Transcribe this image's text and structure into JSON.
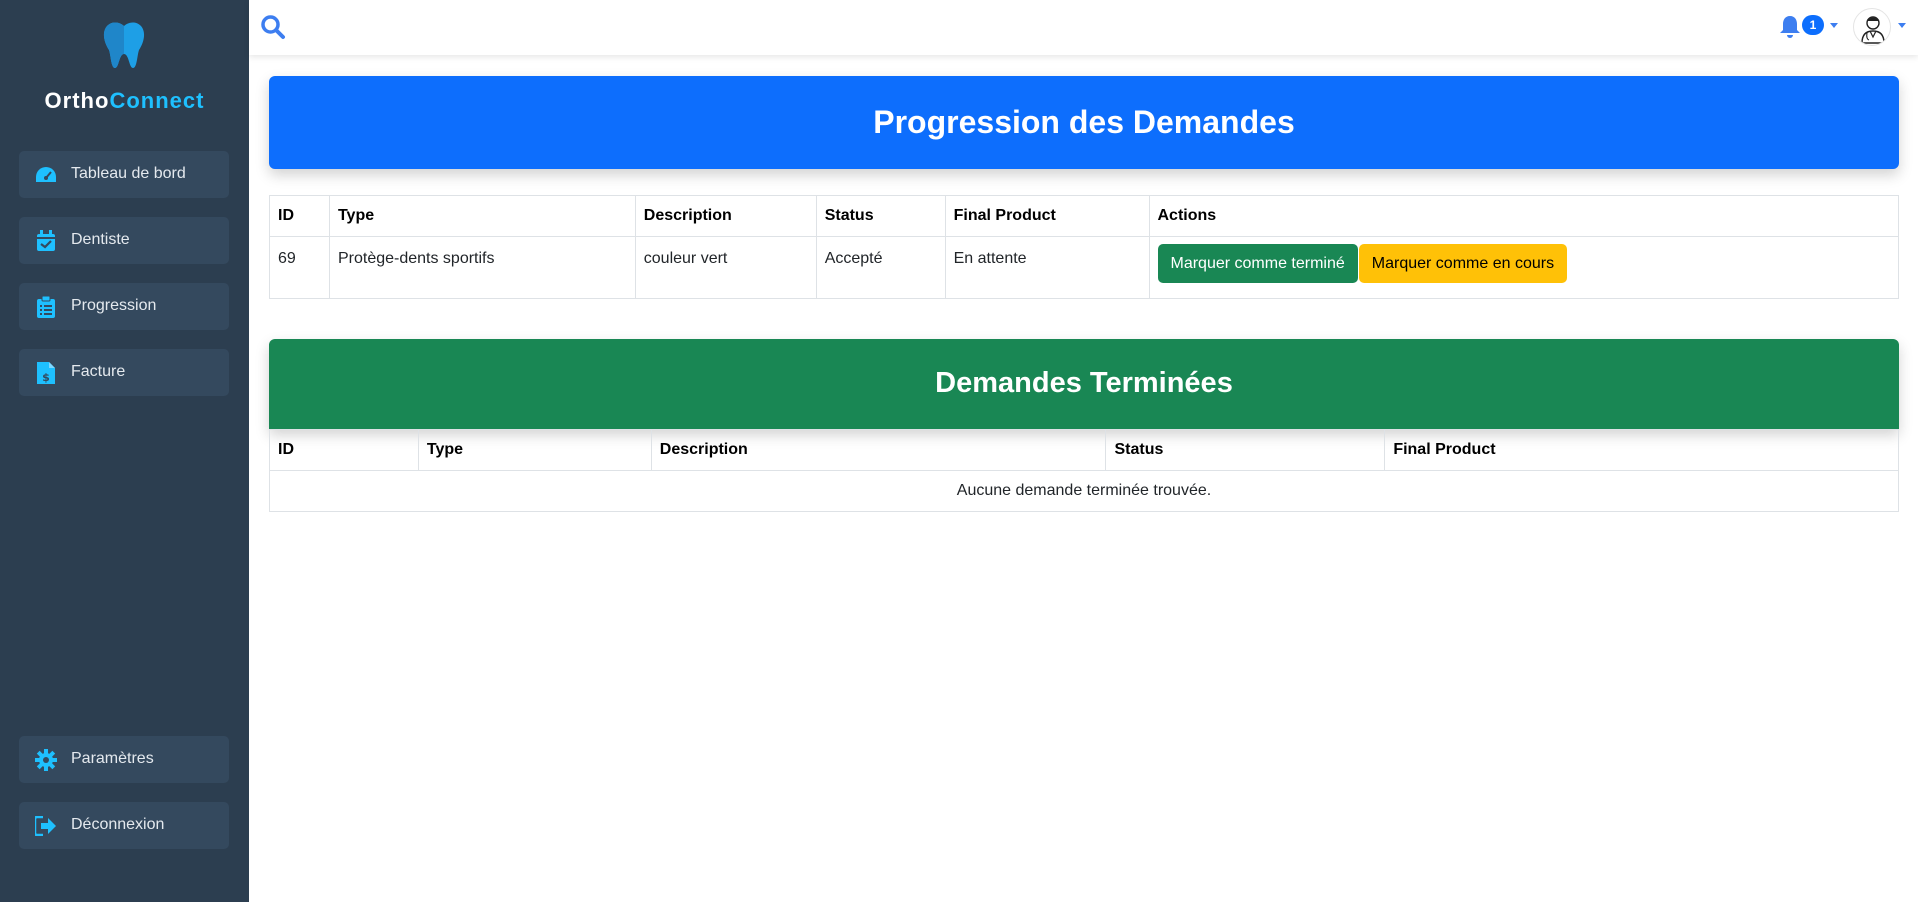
{
  "brand": {
    "part1": "Ortho",
    "part2": "Connect"
  },
  "sidebar": {
    "items": [
      {
        "label": "Tableau de bord",
        "icon": "gauge-icon"
      },
      {
        "label": "Dentiste",
        "icon": "calendar-check-icon"
      },
      {
        "label": "Progression",
        "icon": "clipboard-list-icon"
      },
      {
        "label": "Facture",
        "icon": "invoice-dollar-icon"
      }
    ],
    "bottom": [
      {
        "label": "Paramètres",
        "icon": "gear-icon"
      },
      {
        "label": "Déconnexion",
        "icon": "logout-icon"
      }
    ]
  },
  "topbar": {
    "notification_count": "1"
  },
  "progress": {
    "title": "Progression des Demandes",
    "headers": [
      "ID",
      "Type",
      "Description",
      "Status",
      "Final Product",
      "Actions"
    ],
    "rows": [
      {
        "id": "69",
        "type": "Protège-dents sportifs",
        "description": "couleur vert",
        "status": "Accepté",
        "final_product": "En attente"
      }
    ],
    "btn_done": "Marquer comme terminé",
    "btn_in_progress": "Marquer comme en cours"
  },
  "completed": {
    "title": "Demandes Terminées",
    "headers": [
      "ID",
      "Type",
      "Description",
      "Status",
      "Final Product"
    ],
    "empty": "Aucune demande terminée trouvée."
  },
  "colors": {
    "sidebar": "#2c3e50",
    "accent": "#1ec0ff",
    "primary": "#0d6efd",
    "success": "#198754",
    "warning": "#ffc107"
  }
}
